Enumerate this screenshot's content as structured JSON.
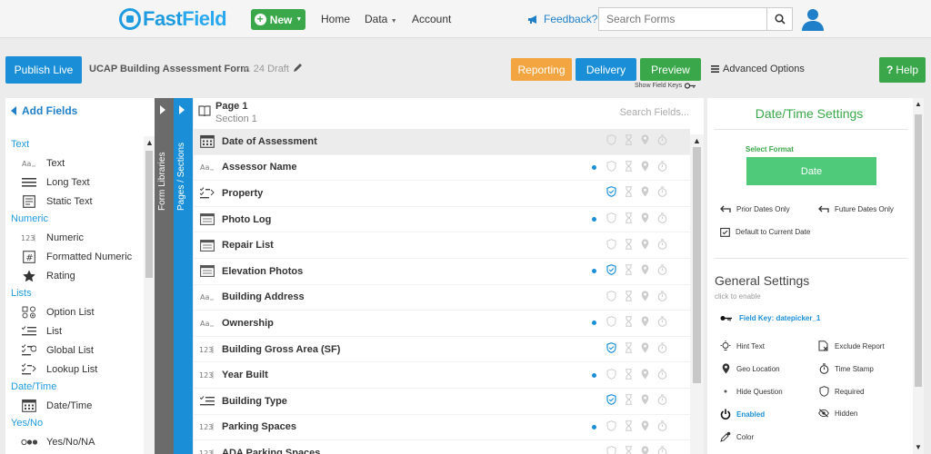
{
  "nav": {
    "logo_fast": "Fast",
    "logo_field": "Field",
    "new_label": "New",
    "home": "Home",
    "data": "Data",
    "account": "Account",
    "feedback": "Feedback?",
    "search_placeholder": "Search Forms"
  },
  "toolbar": {
    "publish": "Publish Live",
    "form_title": "UCAP Building Assessment Form",
    "version": "v. 24 Draft",
    "reporting": "Reporting",
    "delivery": "Delivery",
    "preview": "Preview",
    "show_field_keys": "Show Field Keys",
    "advanced": "Advanced Options",
    "help": "Help"
  },
  "colors": {
    "reporting": "#f2a541",
    "delivery": "#1a8fd8",
    "preview": "#3aa84a",
    "form_libraries_tab": "#6b6b6b",
    "pages_tab": "#1a8fd8"
  },
  "left_panel": {
    "title": "Add Fields",
    "categories": [
      {
        "name": "Text",
        "items": [
          {
            "label": "Text",
            "icon": "text-aa-icon"
          },
          {
            "label": "Long Text",
            "icon": "long-text-icon"
          },
          {
            "label": "Static Text",
            "icon": "static-text-icon"
          }
        ]
      },
      {
        "name": "Numeric",
        "items": [
          {
            "label": "Numeric",
            "icon": "numeric-123-icon"
          },
          {
            "label": "Formatted Numeric",
            "icon": "hash-icon"
          },
          {
            "label": "Rating",
            "icon": "star-icon"
          }
        ]
      },
      {
        "name": "Lists",
        "items": [
          {
            "label": "Option List",
            "icon": "option-list-icon"
          },
          {
            "label": "List",
            "icon": "list-icon"
          },
          {
            "label": "Global List",
            "icon": "global-list-icon"
          },
          {
            "label": "Lookup List",
            "icon": "lookup-list-icon"
          }
        ]
      },
      {
        "name": "Date/Time",
        "items": [
          {
            "label": "Date/Time",
            "icon": "calendar-icon"
          }
        ]
      },
      {
        "name": "Yes/No",
        "items": [
          {
            "label": "Yes/No/NA",
            "icon": "yes-no-icon"
          }
        ]
      }
    ]
  },
  "tabs": {
    "form_libraries": "Form Libraries",
    "pages_sections": "Pages / Sections"
  },
  "center": {
    "page": "Page 1",
    "section": "Section 1",
    "search_placeholder": "Search Fields...",
    "fields": [
      {
        "label": "Date of Assessment",
        "icon": "calendar-icon",
        "dot": false,
        "required": false,
        "selected": true
      },
      {
        "label": "Assessor Name",
        "icon": "text-aa-icon",
        "dot": true,
        "required": false,
        "selected": false
      },
      {
        "label": "Property",
        "icon": "lookup-list-icon",
        "dot": false,
        "required": true,
        "selected": false
      },
      {
        "label": "Photo Log",
        "icon": "repeat-section-icon",
        "dot": true,
        "required": false,
        "selected": false
      },
      {
        "label": "Repair List",
        "icon": "repeat-section-icon",
        "dot": false,
        "required": false,
        "selected": false
      },
      {
        "label": "Elevation Photos",
        "icon": "repeat-section-icon",
        "dot": true,
        "required": true,
        "selected": false
      },
      {
        "label": "Building Address",
        "icon": "text-aa-icon",
        "dot": false,
        "required": false,
        "selected": false
      },
      {
        "label": "Ownership",
        "icon": "text-aa-icon",
        "dot": true,
        "required": false,
        "selected": false
      },
      {
        "label": "Building Gross Area (SF)",
        "icon": "numeric-123-icon",
        "dot": false,
        "required": true,
        "selected": false
      },
      {
        "label": "Year Built",
        "icon": "numeric-123-icon",
        "dot": true,
        "required": false,
        "selected": false
      },
      {
        "label": "Building Type",
        "icon": "list-icon",
        "dot": false,
        "required": true,
        "selected": false
      },
      {
        "label": "Parking Spaces",
        "icon": "numeric-123-icon",
        "dot": true,
        "required": false,
        "selected": false
      },
      {
        "label": "ADA Parking Spaces",
        "icon": "numeric-123-icon",
        "dot": false,
        "required": false,
        "selected": false
      }
    ]
  },
  "right_panel": {
    "title": "Date/Time Settings",
    "select_format": "Select Format",
    "format_value": "Date",
    "prior_dates": "Prior Dates Only",
    "future_dates": "Future Dates Only",
    "default_current": "Default to Current Date",
    "general_title": "General Settings",
    "general_sub": "click to enable",
    "field_key": "Field Key: datepicker_1",
    "options": [
      {
        "label": "Hint Text",
        "icon": "bulb-icon"
      },
      {
        "label": "Exclude Report",
        "icon": "exclude-report-icon"
      },
      {
        "label": "Geo Location",
        "icon": "location-pin-icon"
      },
      {
        "label": "Time Stamp",
        "icon": "stopwatch-icon"
      },
      {
        "label": "Hide Question",
        "icon": "dot-icon"
      },
      {
        "label": "Required",
        "icon": "shield-icon"
      },
      {
        "label": "Enabled",
        "icon": "power-icon",
        "active": true
      },
      {
        "label": "Hidden",
        "icon": "eye-off-icon"
      },
      {
        "label": "Color",
        "icon": "eyedropper-icon"
      }
    ]
  }
}
